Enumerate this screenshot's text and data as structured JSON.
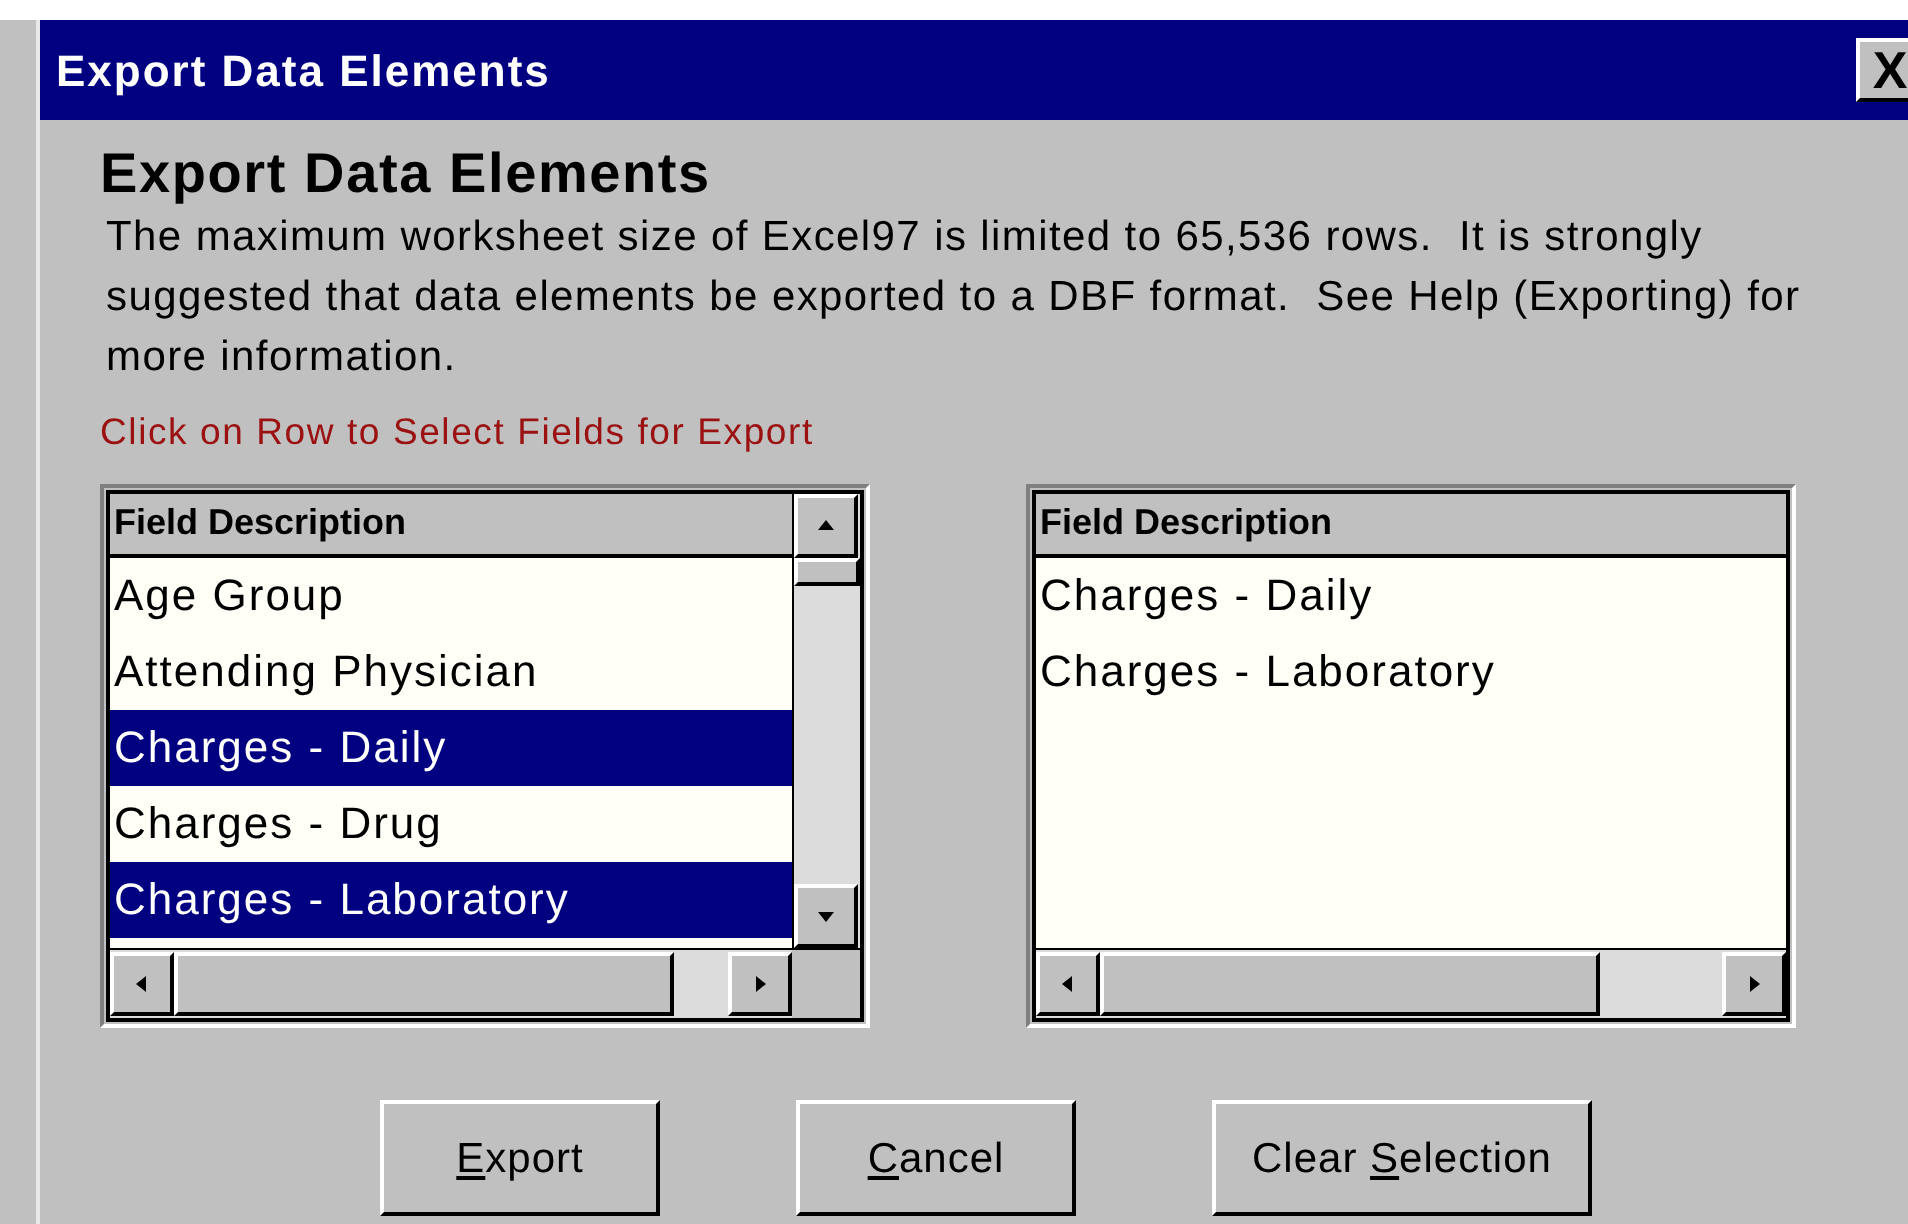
{
  "window": {
    "title": "Export Data Elements",
    "close": "X"
  },
  "heading": "Export Data Elements",
  "description": "The maximum worksheet size of Excel97 is limited to 65,536 rows.  It is strongly suggested that data elements be exported to a DBF format.  See Help (Exporting) for more information.",
  "instruction": "Click on Row to Select Fields for Export",
  "available_fields": {
    "header": "Field Description",
    "rows": [
      {
        "label": "Age Group",
        "selected": false
      },
      {
        "label": "Attending Physician",
        "selected": false
      },
      {
        "label": "Charges - Daily",
        "selected": true
      },
      {
        "label": "Charges - Drug",
        "selected": false
      },
      {
        "label": "Charges - Laboratory",
        "selected": true
      }
    ]
  },
  "selected_fields": {
    "header": "Field Description",
    "rows": [
      "Charges - Daily",
      "Charges - Laboratory"
    ]
  },
  "buttons": [
    {
      "key": "E",
      "after": "xport"
    },
    {
      "key": "C",
      "after": "ancel"
    },
    {
      "before": "Clear ",
      "key": "S",
      "after": "election"
    }
  ]
}
